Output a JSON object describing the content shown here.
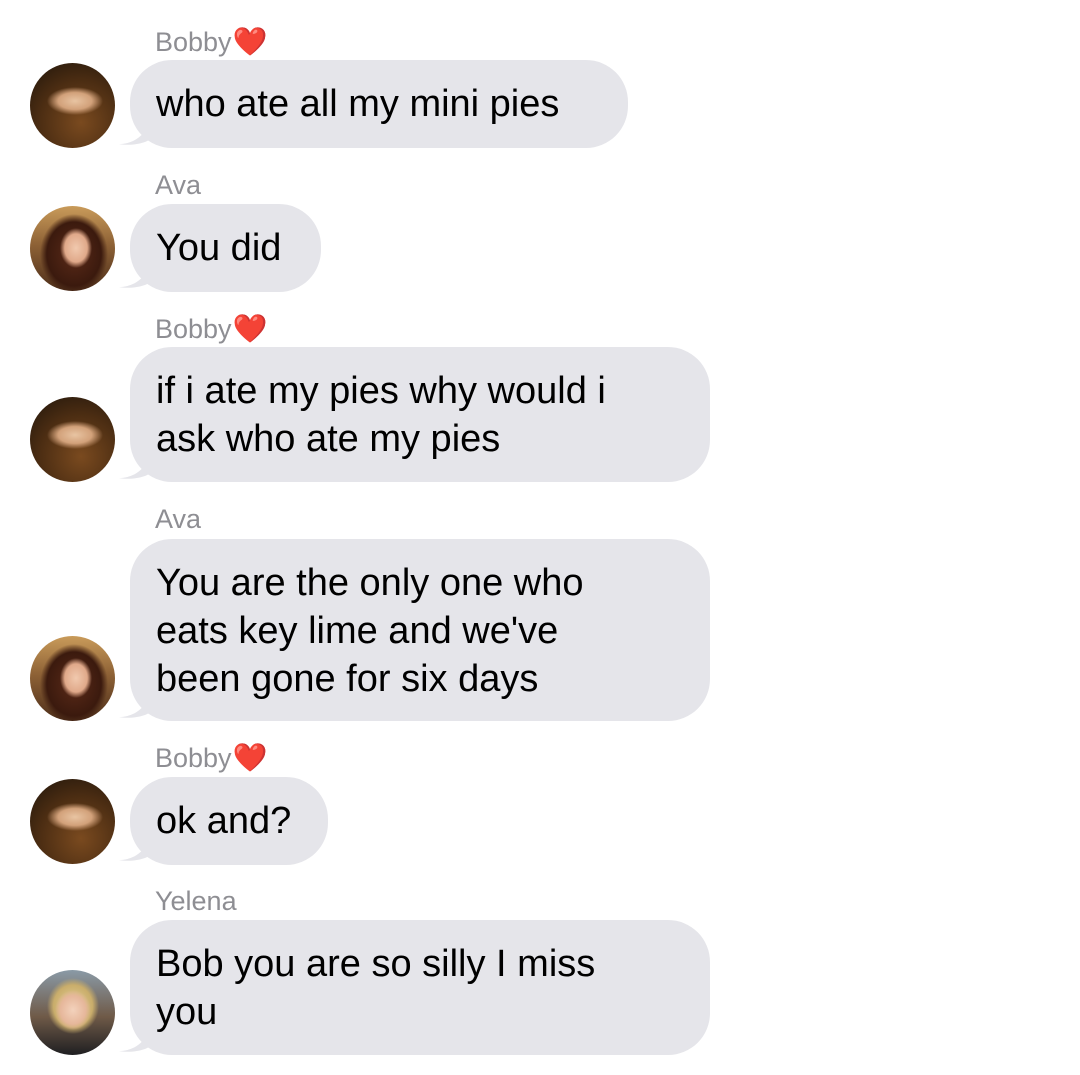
{
  "conversation": {
    "messages": [
      {
        "sender": "Bobby",
        "sender_heart": "❤️",
        "text": "who ate all my mini pies"
      },
      {
        "sender": "Ava",
        "sender_heart": "",
        "text": "You did"
      },
      {
        "sender": "Bobby",
        "sender_heart": "❤️",
        "text": "if i ate my pies why would i\nask who ate my pies"
      },
      {
        "sender": "Ava",
        "sender_heart": "",
        "text": "You are the only one who\neats key lime and we've\nbeen gone for six days"
      },
      {
        "sender": "Bobby",
        "sender_heart": "❤️",
        "text": "ok and?"
      },
      {
        "sender": "Yelena",
        "sender_heart": "",
        "text": "Bob you are so silly I miss\nyou"
      }
    ]
  },
  "colors": {
    "bubble": "#e5e5ea",
    "sender_label": "#8e8e93",
    "heart": "#ff2a2a"
  }
}
